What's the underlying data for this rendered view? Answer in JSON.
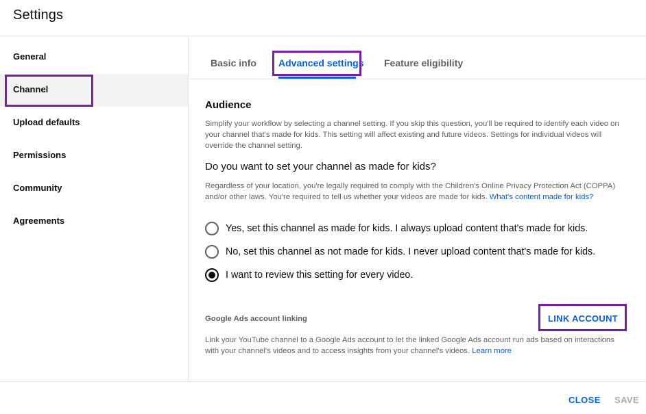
{
  "dialog": {
    "title": "Settings"
  },
  "sidebar": {
    "items": [
      {
        "label": "General"
      },
      {
        "label": "Channel",
        "active": true
      },
      {
        "label": "Upload defaults"
      },
      {
        "label": "Permissions"
      },
      {
        "label": "Community"
      },
      {
        "label": "Agreements"
      }
    ]
  },
  "tabs": [
    {
      "label": "Basic info"
    },
    {
      "label": "Advanced settings",
      "active": true
    },
    {
      "label": "Feature eligibility"
    }
  ],
  "audience": {
    "heading": "Audience",
    "description": "Simplify your workflow by selecting a channel setting. If you skip this question, you'll be required to identify each video on your channel that's made for kids. This setting will affect existing and future videos. Settings for individual videos will override the channel setting.",
    "question": "Do you want to set your channel as made for kids?",
    "legal_text": "Regardless of your location, you're legally required to comply with the Children's Online Privacy Protection Act (COPPA) and/or other laws. You're required to tell us whether your videos are made for kids.",
    "legal_link": "What's content made for kids?",
    "options": [
      {
        "label": "Yes, set this channel as made for kids. I always upload content that's made for kids.",
        "checked": false
      },
      {
        "label": "No, set this channel as not made for kids. I never upload content that's made for kids.",
        "checked": false
      },
      {
        "label": "I want to review this setting for every video.",
        "checked": true
      }
    ]
  },
  "ads": {
    "label": "Google Ads account linking",
    "button": "LINK ACCOUNT",
    "description": "Link your YouTube channel to a Google Ads account to let the linked Google Ads account run ads based on interactions with your channel's videos and to access insights from your channel's videos.",
    "learn_more": "Learn more"
  },
  "footer": {
    "close": "CLOSE",
    "save": "SAVE"
  },
  "colors": {
    "accent": "#065fd4",
    "highlight": "#7a1fa2",
    "selected_bg": "#f2f2f2"
  }
}
